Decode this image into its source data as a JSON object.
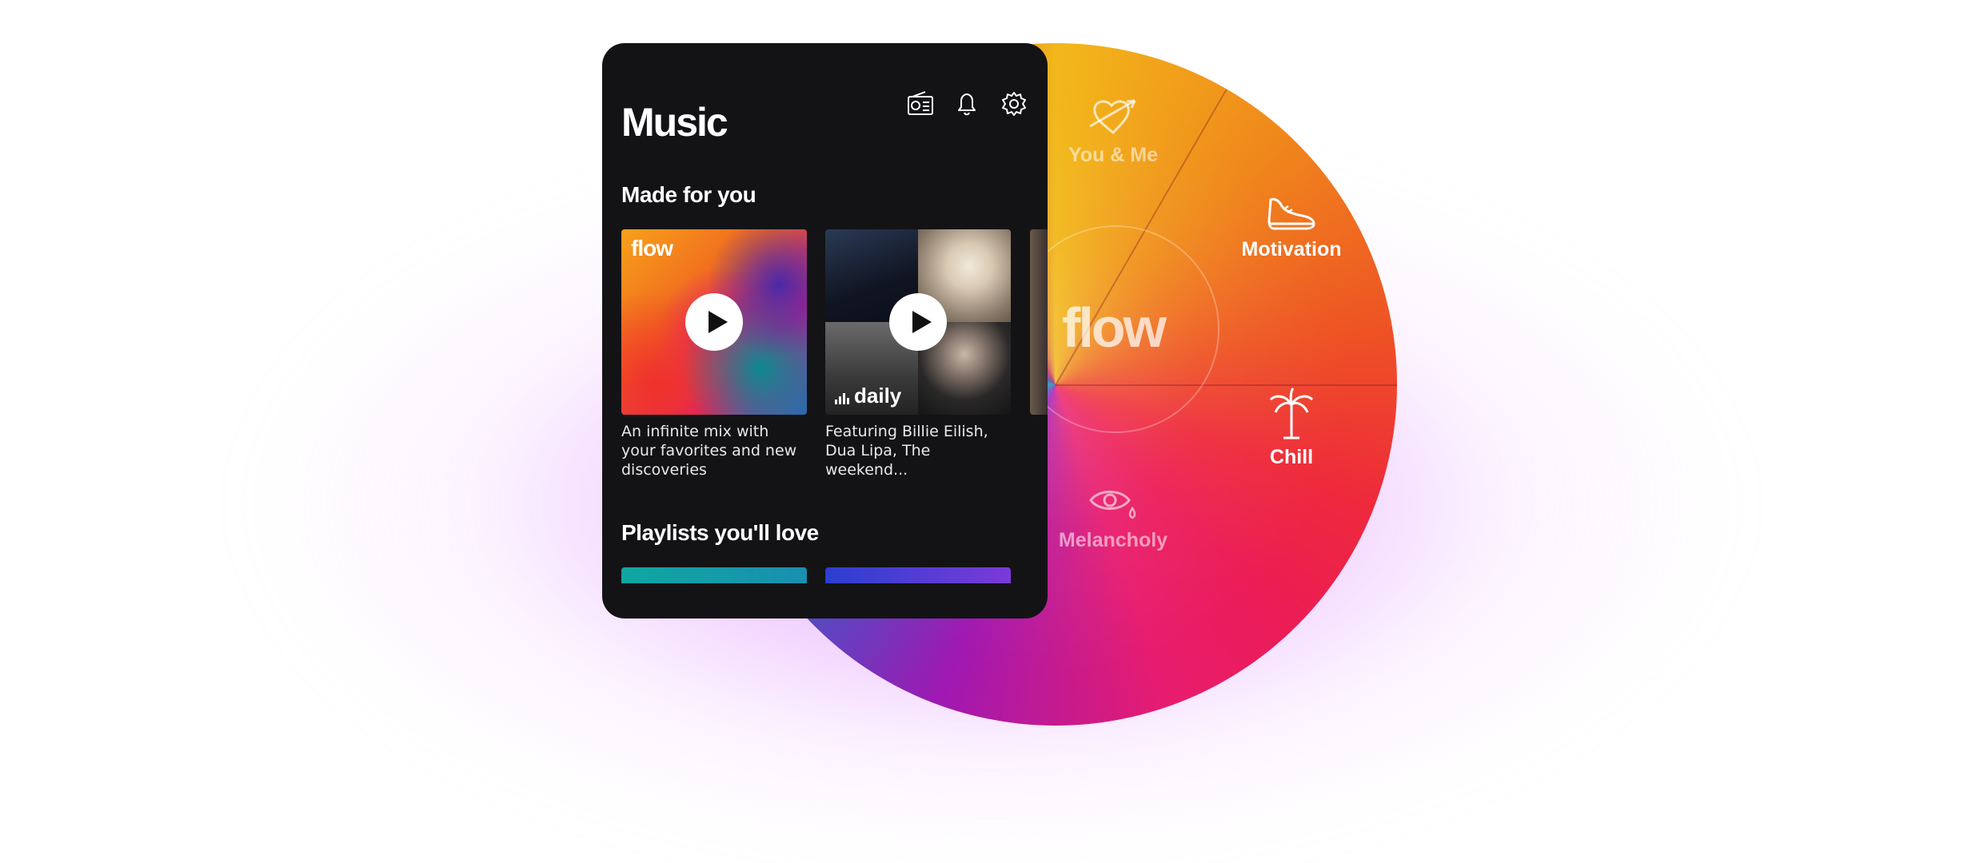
{
  "app": {
    "title": "Music"
  },
  "header_icons": [
    "radio-icon",
    "bell-icon",
    "settings-gear-icon"
  ],
  "sections": {
    "made_for_you": "Made for you",
    "playlists": "Playlists you'll love"
  },
  "cards": [
    {
      "label": "flow",
      "description": "An infinite mix with your favorites and new discoveries"
    },
    {
      "label": "daily",
      "description": "Featuring Billie Eilish, Dua Lipa, The weekend..."
    }
  ],
  "wheel": {
    "center_label": "flow",
    "moods": [
      {
        "label": "You & Me",
        "icon": "heart-arrow-icon"
      },
      {
        "label": "Motivation",
        "icon": "sneaker-icon"
      },
      {
        "label": "Chill",
        "icon": "palm-tree-icon"
      },
      {
        "label": "Melancholy",
        "icon": "eye-tear-icon"
      }
    ]
  },
  "colors": {
    "phone_bg": "#131316",
    "accent_purple": "#c850ff"
  }
}
